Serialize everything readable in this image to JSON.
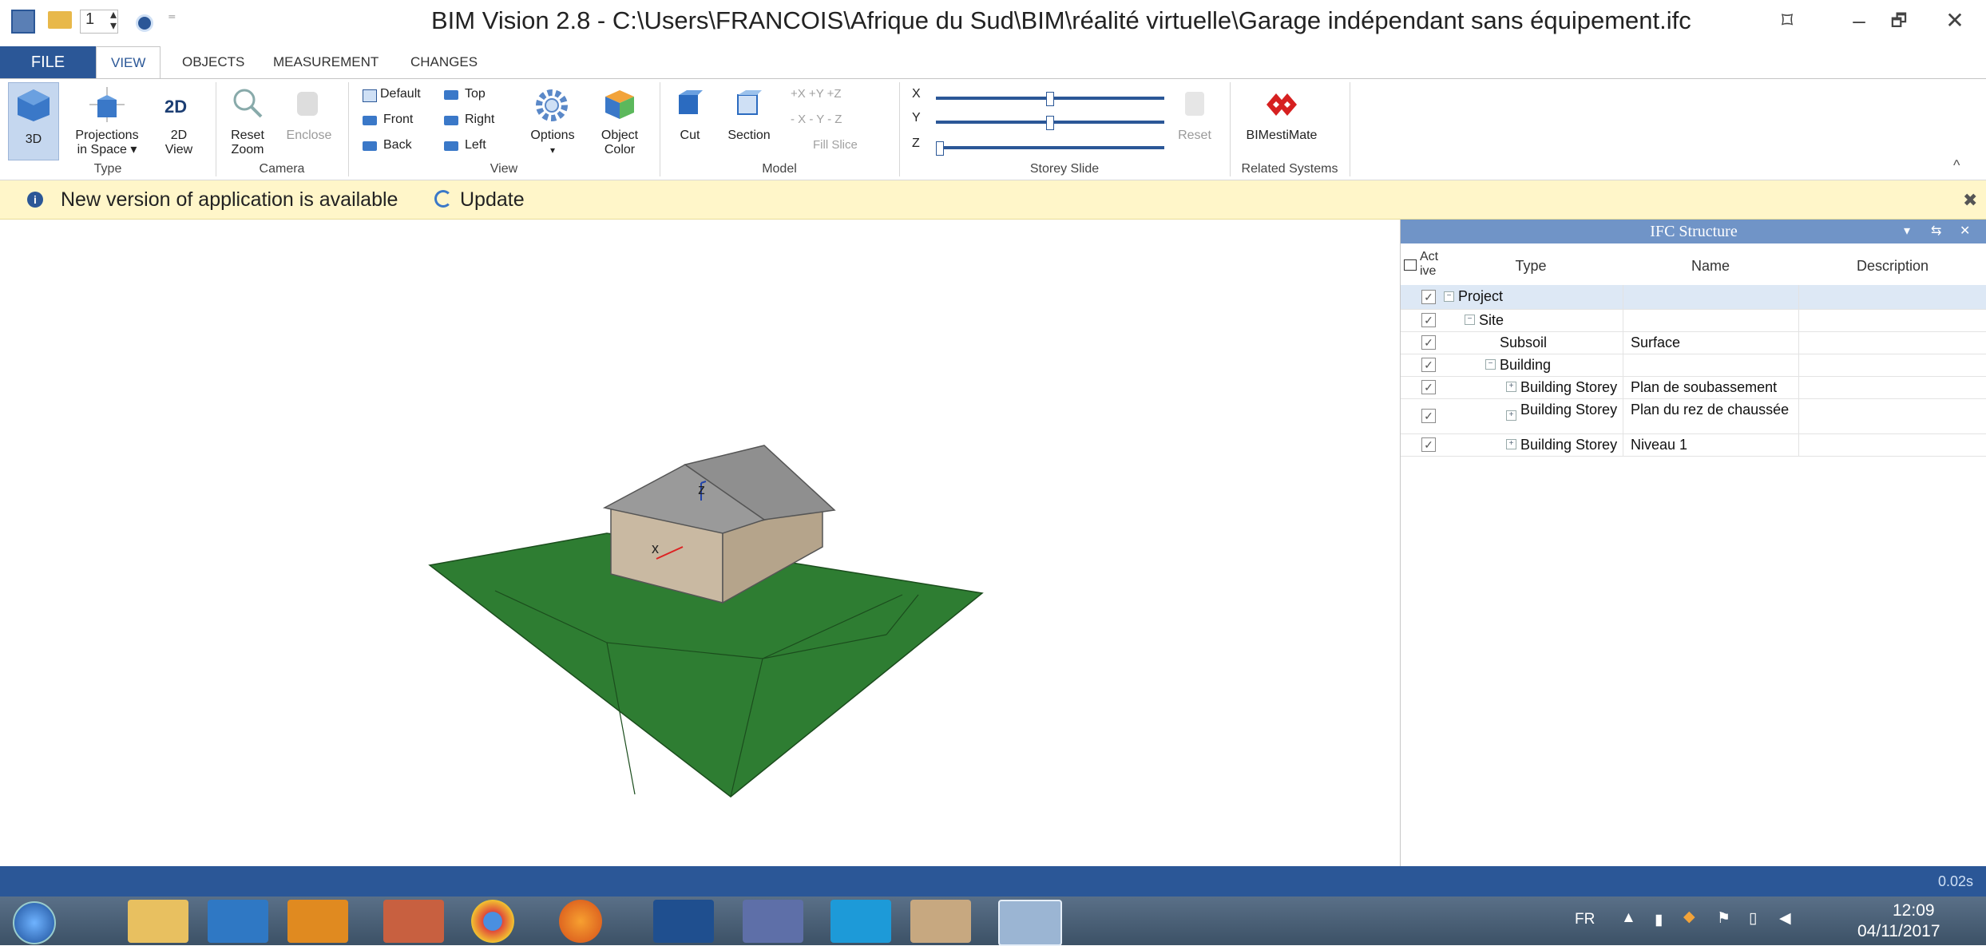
{
  "window": {
    "title": "BIM Vision 2.8 - C:\\Users\\FRANCOIS\\Afrique du Sud\\BIM\\réalité virtuelle\\Garage indépendant sans équipement.ifc",
    "qa_value": "1",
    "controls": {
      "restore_down": "⌑",
      "minimize": "–",
      "maximize": "🗗",
      "close": "✕"
    }
  },
  "tabs": [
    {
      "label": "FILE"
    },
    {
      "label": "VIEW"
    },
    {
      "label": "OBJECTS"
    },
    {
      "label": "MEASUREMENT"
    },
    {
      "label": "CHANGES"
    }
  ],
  "ribbon": {
    "type": {
      "label": "Type",
      "btn_3d": "3D",
      "btn_proj": "Projections\nin Space ▾",
      "btn_2d_icon": "2D",
      "btn_2d": "2D\nView"
    },
    "camera": {
      "label": "Camera",
      "reset_zoom": "Reset\nZoom",
      "enclose": "Enclose"
    },
    "view": {
      "label": "View",
      "default": "Default",
      "top": "Top",
      "front": "Front",
      "right": "Right",
      "back": "Back",
      "left": "Left",
      "options": "Options",
      "options_arrow": "▾",
      "object_color": "Object\nColor"
    },
    "model": {
      "label": "Model",
      "cut": "Cut",
      "section": "Section",
      "plus": "+X  +Y  +Z",
      "minus": "- X  - Y  - Z",
      "fill_slice": "Fill Slice"
    },
    "storey": {
      "label": "Storey Slide",
      "x": "X",
      "y": "Y",
      "z": "Z",
      "reset": "Reset",
      "x_level": 0.5,
      "y_level": 0.5,
      "z_level": 0.0
    },
    "related": {
      "label": "Related Systems",
      "bimestimate": "BIMestiMate"
    },
    "collapse": "^"
  },
  "notification": {
    "message": "New version of application is available",
    "update": "Update",
    "close": "✖"
  },
  "viewport": {
    "axis_x": "x",
    "axis_z": "z"
  },
  "ifc_panel": {
    "title": "IFC Structure",
    "head_buttons": [
      "▾",
      "⇆",
      "✕"
    ],
    "columns": {
      "active": "Act\nive",
      "type": "Type",
      "name": "Name",
      "description": "Description"
    },
    "rows": [
      {
        "type": "Project",
        "name": "",
        "checked": true,
        "level": 0,
        "expander": "−"
      },
      {
        "type": "Site",
        "name": "",
        "checked": true,
        "level": 1,
        "expander": "−"
      },
      {
        "type": "Subsoil",
        "name": "Surface",
        "checked": true,
        "level": 2,
        "expander": ""
      },
      {
        "type": "Building",
        "name": "",
        "checked": true,
        "level": 2,
        "expander": "−"
      },
      {
        "type": "Building Storey",
        "name": "Plan de soubassement",
        "checked": true,
        "level": 3,
        "expander": "+"
      },
      {
        "type": "Building Storey",
        "name": "Plan du rez de chaussée",
        "checked": true,
        "level": 3,
        "expander": "+"
      },
      {
        "type": "Building Storey",
        "name": "Niveau 1",
        "checked": true,
        "level": 3,
        "expander": "+"
      }
    ]
  },
  "status": {
    "time": "0.02s"
  },
  "taskbar": {
    "lang": "FR",
    "clock_time": "12:09",
    "clock_date": "04/11/2017",
    "apps": [
      "start-orb",
      "file-explorer",
      "internet-explorer",
      "office",
      "paint",
      "chrome",
      "firefox",
      "autocad",
      "curve-app",
      "skype",
      "archive-app",
      "bim-vision"
    ]
  },
  "colors": {
    "accent": "#2b5797",
    "panel_header": "#7094c7",
    "notification": "#fff6c9",
    "ground": "#2e7d32",
    "roof": "#8f8f8f",
    "wall": "#c9b9a2"
  }
}
